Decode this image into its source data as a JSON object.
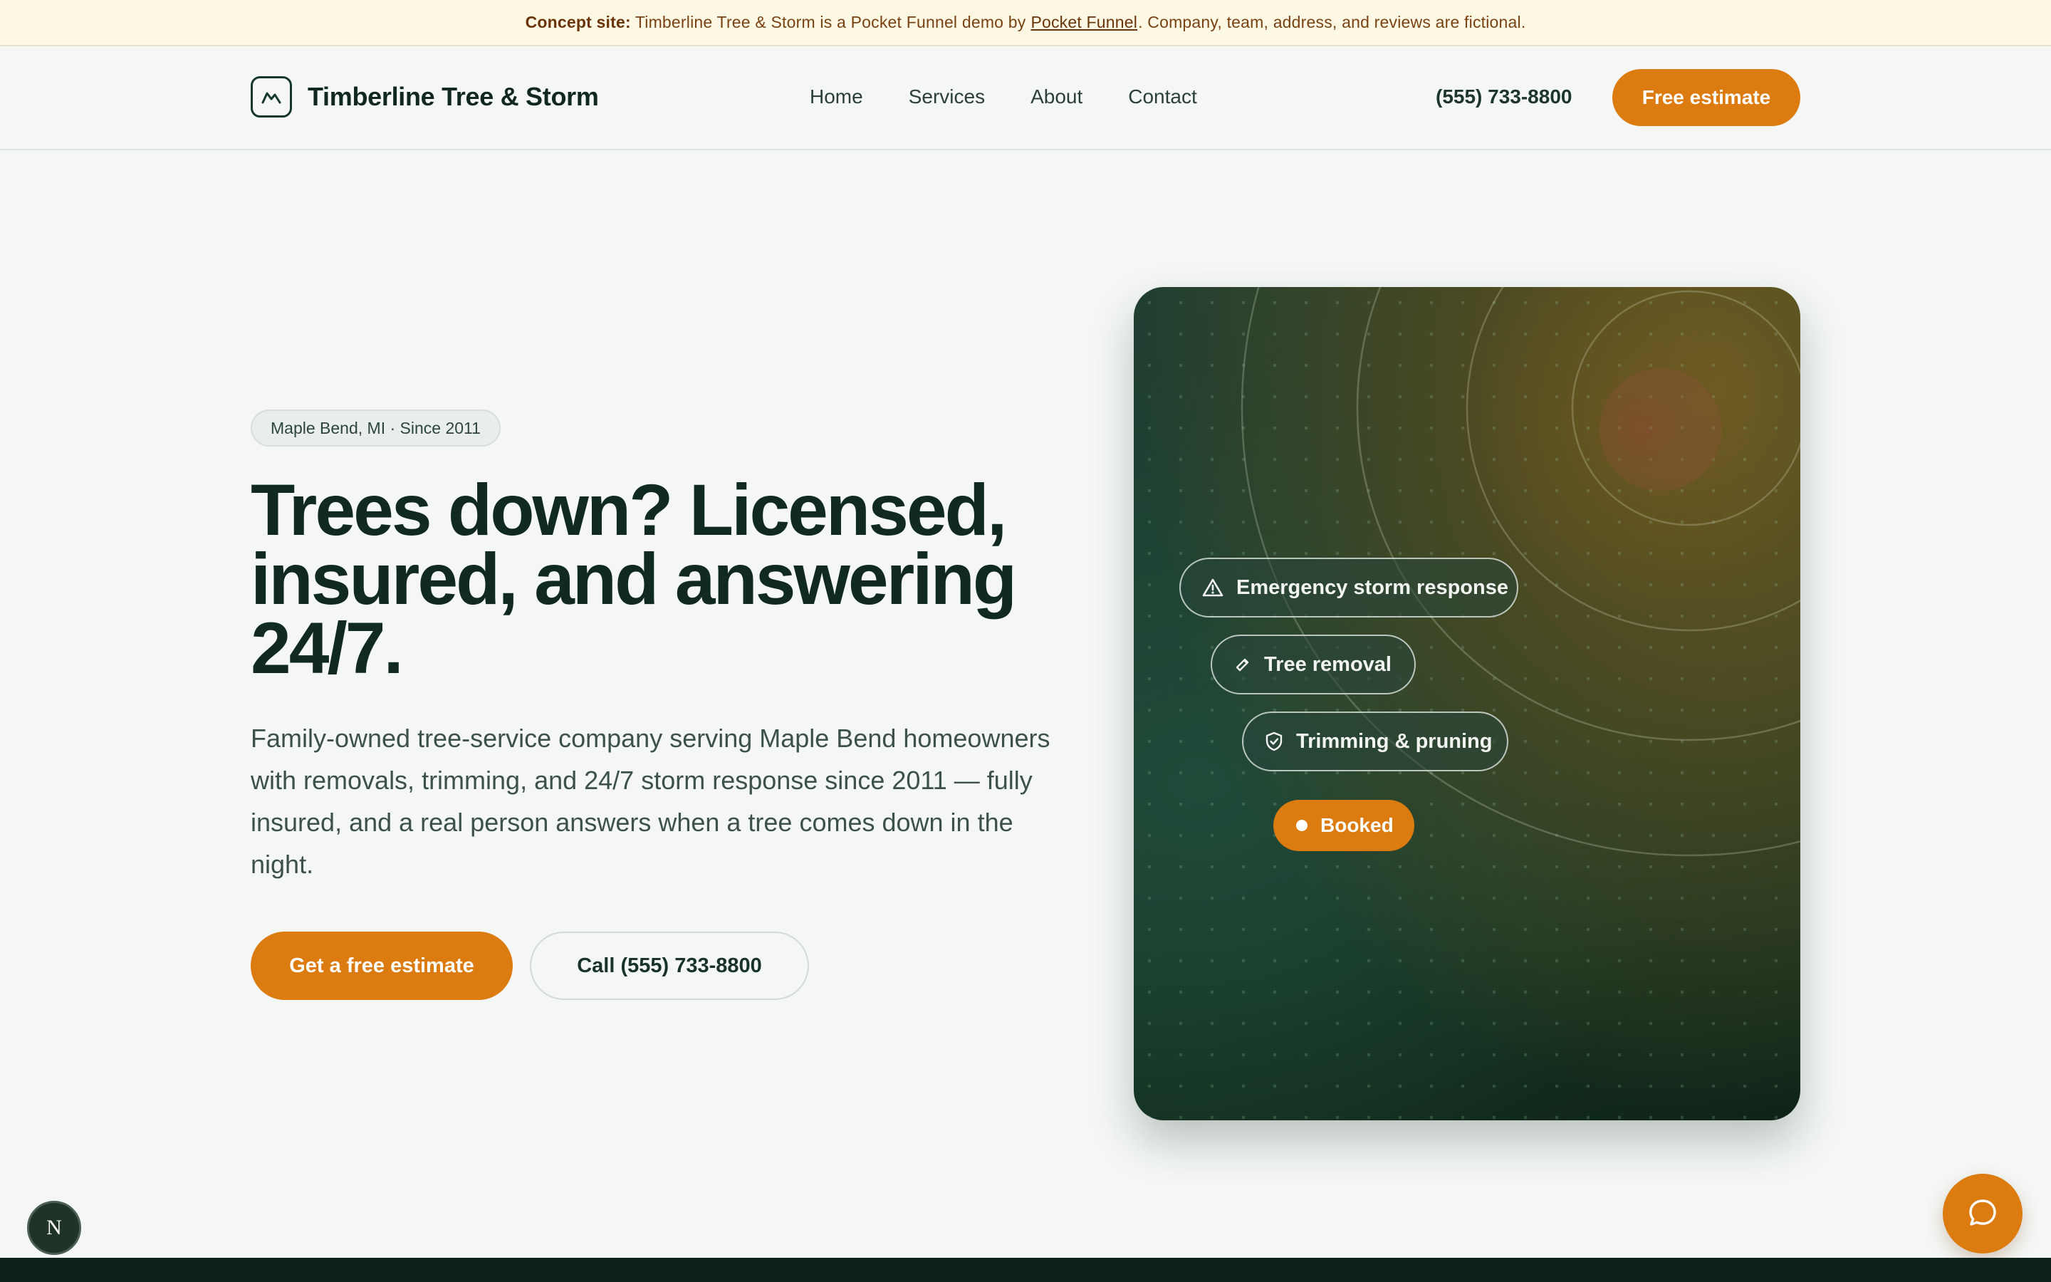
{
  "banner": {
    "label": "Concept site:",
    "text_before": "Timberline Tree & Storm is a Pocket Funnel demo by",
    "link": "Pocket Funnel",
    "text_after": ". Company, team, address, and reviews are fictional."
  },
  "header": {
    "brand_name": "Timberline Tree & Storm",
    "brand_icon": "mountain-logo-icon",
    "nav": [
      "Home",
      "Services",
      "About",
      "Contact"
    ],
    "phone": "(555) 733-8800",
    "cta": "Free estimate"
  },
  "hero": {
    "badge": "Maple Bend, MI · Since 2011",
    "title": "Trees down? Licensed, insured, and answering 24/7.",
    "copy": "Family-owned tree-service company serving Maple Bend homeowners with removals, trimming, and 24/7 storm response since 2011 — fully insured, and a real person answers when a tree comes down in the night.",
    "primary_cta": "Get a free estimate",
    "secondary_cta": "Call (555) 733-8800"
  },
  "card": {
    "chips": [
      {
        "label": "Emergency storm response",
        "icon": "warning-triangle-icon"
      },
      {
        "label": "Tree removal",
        "icon": "saw-icon"
      },
      {
        "label": "Trimming & pruning",
        "icon": "shield-check-icon"
      }
    ],
    "status": "Booked"
  },
  "floating": {
    "badge_letter": "N",
    "chat_icon": "chat-bubble-icon"
  },
  "colors": {
    "accent": "#dc7b0f",
    "brand_dark": "#102a20",
    "banner_bg": "#fdf8e4",
    "page_bg": "#f4f7f5",
    "card_green": "#1a3b2e"
  }
}
